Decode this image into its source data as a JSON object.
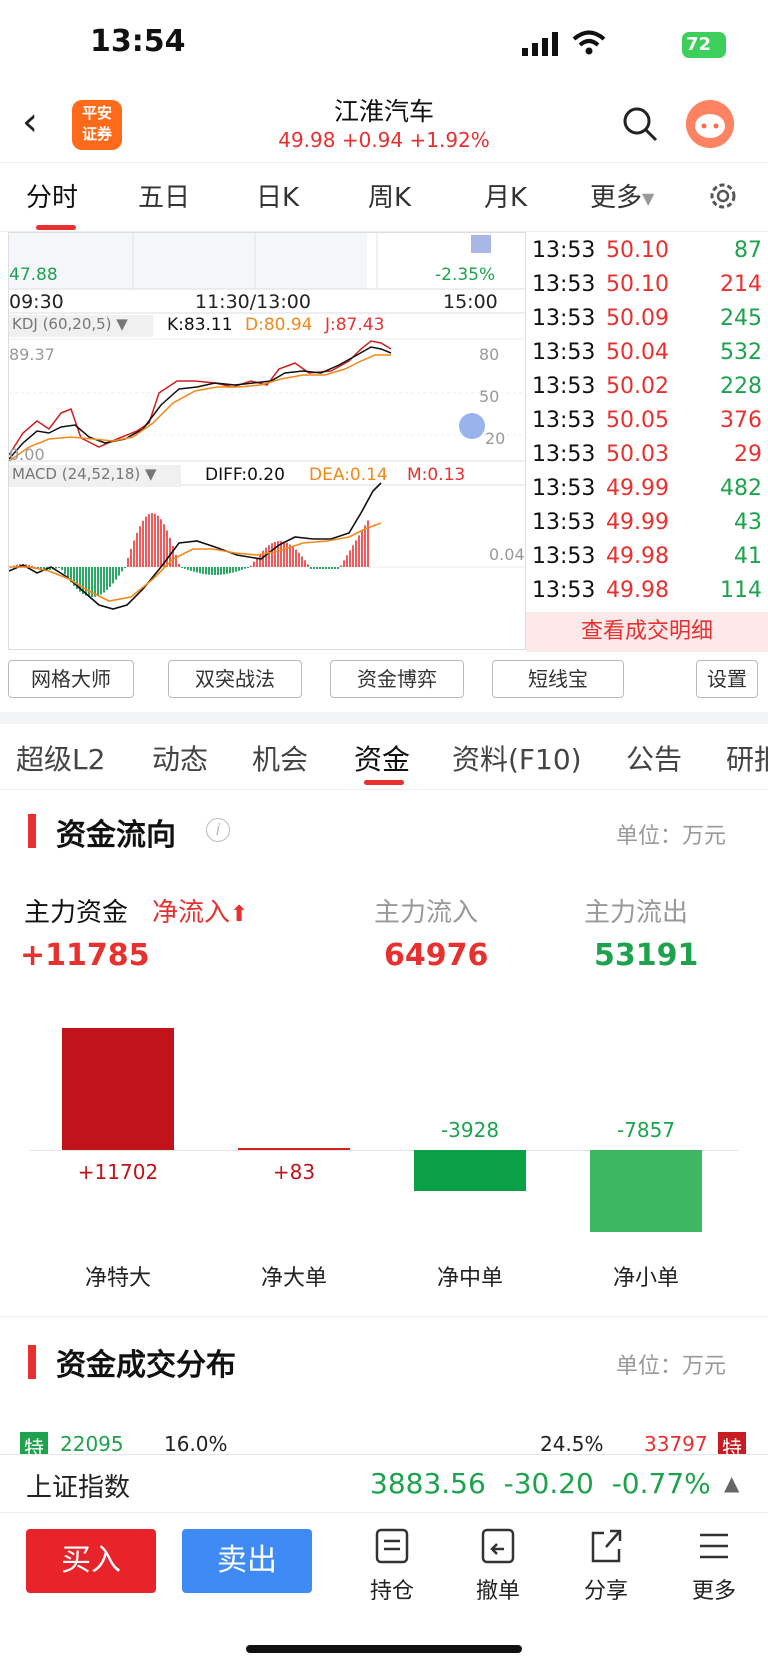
{
  "status": {
    "time": "13:54",
    "battery": "72"
  },
  "header": {
    "logo_text": "平安\n证券",
    "stock_name": "江淮汽车",
    "quote": "49.98 +0.94 +1.92%"
  },
  "period_tabs": [
    "分时",
    "五日",
    "日K",
    "周K",
    "月K",
    "更多"
  ],
  "chart": {
    "price_low": "47.88",
    "pct_low": "-2.35%",
    "time_start": "09:30",
    "time_mid": "11:30/13:00",
    "time_end": "15:00",
    "kdj_param": "KDJ (60,20,5) ▼",
    "kdj_k": "K:83.11",
    "kdj_d": "D:80.94",
    "kdj_j": "J:87.43",
    "kdj_top": "89.37",
    "kdj_bottom": "0.00",
    "kdj_80": "80",
    "kdj_50": "50",
    "kdj_20": "20",
    "macd_param": "MACD (24,52,18) ▼",
    "macd_diff": "DIFF:0.20",
    "macd_dea": "DEA:0.14",
    "macd_m": "M:0.13",
    "macd_level": "0.04"
  },
  "ticks": [
    {
      "time": "13:53",
      "price": "50.10",
      "vol": "87",
      "vol_color": "green"
    },
    {
      "time": "13:53",
      "price": "50.10",
      "vol": "214",
      "vol_color": "red"
    },
    {
      "time": "13:53",
      "price": "50.09",
      "vol": "245",
      "vol_color": "green"
    },
    {
      "time": "13:53",
      "price": "50.04",
      "vol": "532",
      "vol_color": "green"
    },
    {
      "time": "13:53",
      "price": "50.02",
      "vol": "228",
      "vol_color": "green"
    },
    {
      "time": "13:53",
      "price": "50.05",
      "vol": "376",
      "vol_color": "red"
    },
    {
      "time": "13:53",
      "price": "50.03",
      "vol": "29",
      "vol_color": "red"
    },
    {
      "time": "13:53",
      "price": "49.99",
      "vol": "482",
      "vol_color": "green"
    },
    {
      "time": "13:53",
      "price": "49.99",
      "vol": "43",
      "vol_color": "green"
    },
    {
      "time": "13:53",
      "price": "49.98",
      "vol": "41",
      "vol_color": "green"
    },
    {
      "time": "13:53",
      "price": "49.98",
      "vol": "114",
      "vol_color": "green"
    }
  ],
  "detail_button": "查看成交明细",
  "tools": [
    "网格大师",
    "双突战法",
    "资金博弈",
    "短线宝",
    "设置"
  ],
  "info_tabs": [
    "超级L2",
    "动态",
    "机会",
    "资金",
    "资料(F10)",
    "公告",
    "研报"
  ],
  "fund_flow": {
    "title": "资金流向",
    "unit": "单位：万元",
    "main_label": "主力资金",
    "net_label": "净流入",
    "net_value": "+11785",
    "in_label": "主力流入",
    "in_value": "64976",
    "out_label": "主力流出",
    "out_value": "53191"
  },
  "chart_data": {
    "type": "bar",
    "categories": [
      "净特大",
      "净大单",
      "净中单",
      "净小单"
    ],
    "values": [
      11702,
      83,
      -3928,
      -7857
    ],
    "value_labels": [
      "+11702",
      "+83",
      "-3928",
      "-7857"
    ]
  },
  "distribution": {
    "title": "资金成交分布",
    "unit": "单位：万元",
    "left_tag": "特",
    "left_value": "22095",
    "left_pct": "16.0%",
    "right_pct": "24.5%",
    "right_value": "33797",
    "right_tag": "特"
  },
  "index": {
    "name": "上证指数",
    "price": "3883.56",
    "change": "-30.20",
    "pct": "-0.77%"
  },
  "bottom": {
    "buy": "买入",
    "sell": "卖出",
    "hold": "持仓",
    "cancel": "撤单",
    "share": "分享",
    "more": "更多"
  }
}
